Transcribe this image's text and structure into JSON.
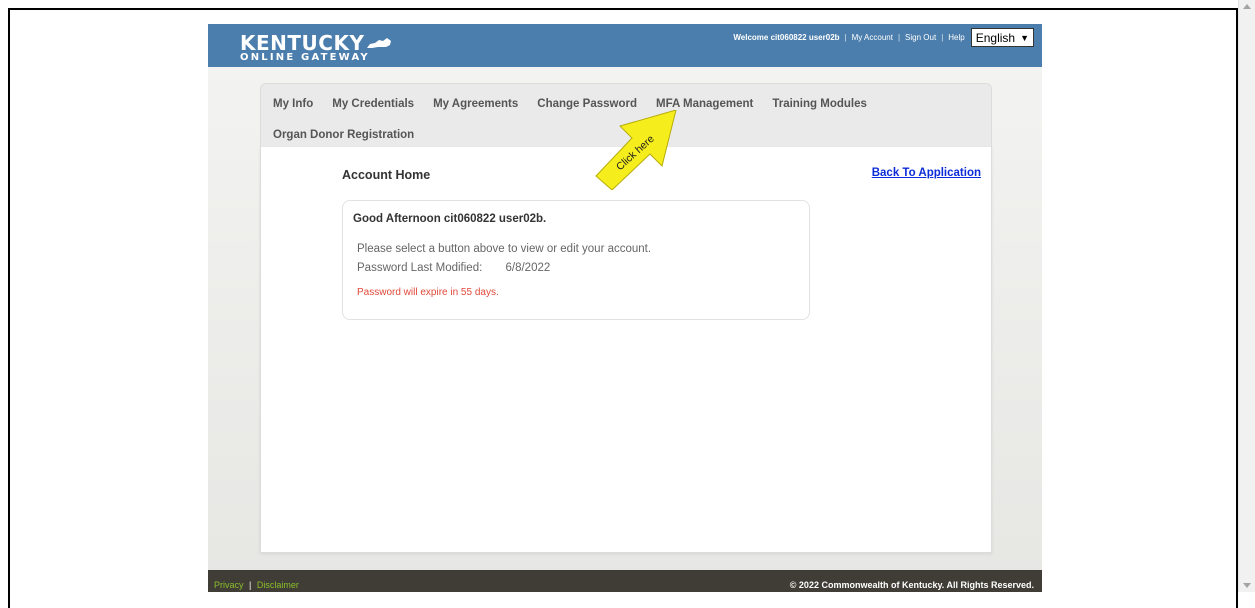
{
  "header": {
    "logo_line1": "KENTUCKY",
    "logo_line2": "ONLINE GATEWAY",
    "welcome": "Welcome cit060822 user02b",
    "my_account": "My Account",
    "sign_out": "Sign Out",
    "help": "Help",
    "language": "English"
  },
  "nav": {
    "items": [
      "My Info",
      "My Credentials",
      "My Agreements",
      "Change Password",
      "MFA Management",
      "Training Modules",
      "Organ Donor Registration"
    ]
  },
  "callout": {
    "label": "Click here",
    "color": "#f6ee1c"
  },
  "main": {
    "title": "Account Home",
    "back_link": "Back To Application",
    "greeting": "Good Afternoon cit060822 user02b.",
    "instruction": "Please select a button above to view or edit your account.",
    "password_label": "Password Last Modified:",
    "password_date": "6/8/2022",
    "expire_warning": "Password will expire in 55 days."
  },
  "footer": {
    "privacy": "Privacy",
    "separator": "|",
    "disclaimer": "Disclaimer",
    "copyright": "© 2022 Commonwealth of Kentucky. All Rights Reserved."
  },
  "colors": {
    "header_bg": "#4b7eac",
    "footer_bg": "#3f3d36",
    "link_blue": "#0b2cd8",
    "warning_red": "#e0493a",
    "footer_link_green": "#8bbf2a"
  }
}
